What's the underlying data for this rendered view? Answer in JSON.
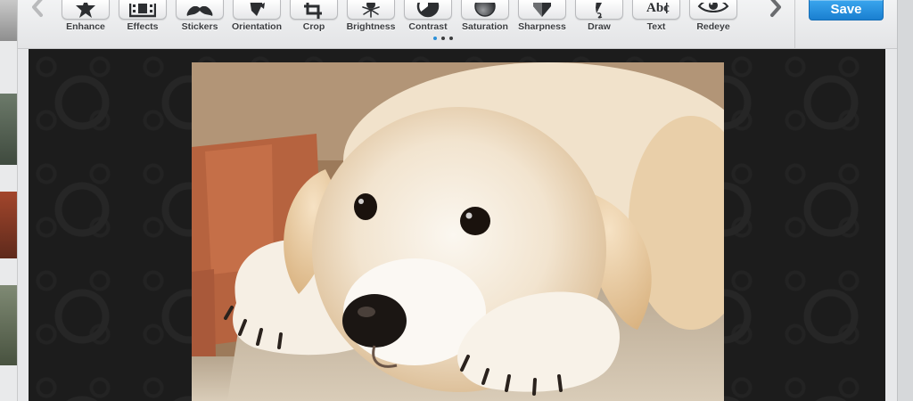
{
  "toolbar": {
    "prev_icon": "chevron-left-icon",
    "next_icon": "chevron-right-icon",
    "tools": [
      {
        "id": "enhance",
        "label": "Enhance",
        "icon": "star-icon"
      },
      {
        "id": "effects",
        "label": "Effects",
        "icon": "film-icon"
      },
      {
        "id": "stickers",
        "label": "Stickers",
        "icon": "mustache-icon"
      },
      {
        "id": "orientation",
        "label": "Orientation",
        "icon": "rotate-icon"
      },
      {
        "id": "crop",
        "label": "Crop",
        "icon": "crop-icon"
      },
      {
        "id": "brightness",
        "label": "Brightness",
        "icon": "sun-icon"
      },
      {
        "id": "contrast",
        "label": "Contrast",
        "icon": "contrast-icon"
      },
      {
        "id": "saturation",
        "label": "Saturation",
        "icon": "saturation-icon"
      },
      {
        "id": "sharpness",
        "label": "Sharpness",
        "icon": "sharpness-icon"
      },
      {
        "id": "draw",
        "label": "Draw",
        "icon": "pen-icon"
      },
      {
        "id": "text",
        "label": "Text",
        "icon": "text-icon"
      },
      {
        "id": "redeye",
        "label": "Redeye",
        "icon": "eye-icon"
      }
    ],
    "pager": {
      "pages": 3,
      "active": 1
    },
    "save_label": "Save"
  },
  "colors": {
    "accent": "#1a8ae0",
    "canvas_bg": "#1c1c1c",
    "toolbar_bg": "#eceded"
  },
  "canvas": {
    "image": "puppy-photo"
  }
}
